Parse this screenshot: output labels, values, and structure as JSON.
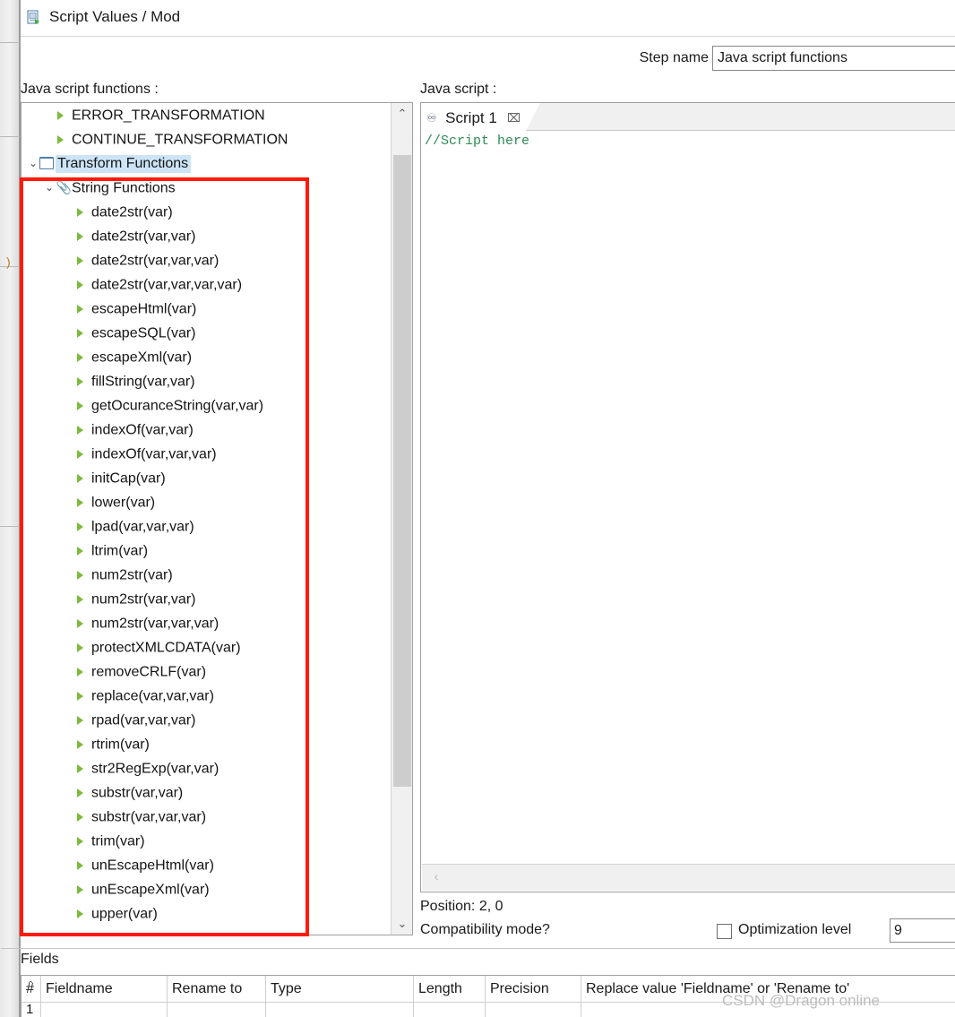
{
  "window": {
    "title": "Script Values / Mod",
    "title_icon": "script-document-icon"
  },
  "step": {
    "label": "Step name",
    "value": "Java script functions",
    "placeholder": ""
  },
  "left_panel": {
    "label": "Java script functions :",
    "tree": [
      {
        "level": 1,
        "icon": "green-arrow-icon",
        "label": "ERROR_TRANSFORMATION",
        "selected": false,
        "twisty": ""
      },
      {
        "level": 1,
        "icon": "green-arrow-icon",
        "label": "CONTINUE_TRANSFORMATION",
        "selected": false,
        "twisty": ""
      },
      {
        "level": 0,
        "icon": "folder-icon",
        "label": "Transform Functions",
        "selected": true,
        "twisty": "⌄"
      },
      {
        "level": 1,
        "icon": "clip-icon",
        "label": "String Functions",
        "selected": false,
        "twisty": "⌄"
      },
      {
        "level": 2,
        "icon": "green-arrow-icon",
        "label": "date2str(var)",
        "selected": false,
        "twisty": ""
      },
      {
        "level": 2,
        "icon": "green-arrow-icon",
        "label": "date2str(var,var)",
        "selected": false,
        "twisty": ""
      },
      {
        "level": 2,
        "icon": "green-arrow-icon",
        "label": "date2str(var,var,var)",
        "selected": false,
        "twisty": ""
      },
      {
        "level": 2,
        "icon": "green-arrow-icon",
        "label": "date2str(var,var,var,var)",
        "selected": false,
        "twisty": ""
      },
      {
        "level": 2,
        "icon": "green-arrow-icon",
        "label": "escapeHtml(var)",
        "selected": false,
        "twisty": ""
      },
      {
        "level": 2,
        "icon": "green-arrow-icon",
        "label": "escapeSQL(var)",
        "selected": false,
        "twisty": ""
      },
      {
        "level": 2,
        "icon": "green-arrow-icon",
        "label": "escapeXml(var)",
        "selected": false,
        "twisty": ""
      },
      {
        "level": 2,
        "icon": "green-arrow-icon",
        "label": "fillString(var,var)",
        "selected": false,
        "twisty": ""
      },
      {
        "level": 2,
        "icon": "green-arrow-icon",
        "label": "getOcuranceString(var,var)",
        "selected": false,
        "twisty": ""
      },
      {
        "level": 2,
        "icon": "green-arrow-icon",
        "label": "indexOf(var,var)",
        "selected": false,
        "twisty": ""
      },
      {
        "level": 2,
        "icon": "green-arrow-icon",
        "label": "indexOf(var,var,var)",
        "selected": false,
        "twisty": ""
      },
      {
        "level": 2,
        "icon": "green-arrow-icon",
        "label": "initCap(var)",
        "selected": false,
        "twisty": ""
      },
      {
        "level": 2,
        "icon": "green-arrow-icon",
        "label": "lower(var)",
        "selected": false,
        "twisty": ""
      },
      {
        "level": 2,
        "icon": "green-arrow-icon",
        "label": "lpad(var,var,var)",
        "selected": false,
        "twisty": ""
      },
      {
        "level": 2,
        "icon": "green-arrow-icon",
        "label": "ltrim(var)",
        "selected": false,
        "twisty": ""
      },
      {
        "level": 2,
        "icon": "green-arrow-icon",
        "label": "num2str(var)",
        "selected": false,
        "twisty": ""
      },
      {
        "level": 2,
        "icon": "green-arrow-icon",
        "label": "num2str(var,var)",
        "selected": false,
        "twisty": ""
      },
      {
        "level": 2,
        "icon": "green-arrow-icon",
        "label": "num2str(var,var,var)",
        "selected": false,
        "twisty": ""
      },
      {
        "level": 2,
        "icon": "green-arrow-icon",
        "label": "protectXMLCDATA(var)",
        "selected": false,
        "twisty": ""
      },
      {
        "level": 2,
        "icon": "green-arrow-icon",
        "label": "removeCRLF(var)",
        "selected": false,
        "twisty": ""
      },
      {
        "level": 2,
        "icon": "green-arrow-icon",
        "label": "replace(var,var,var)",
        "selected": false,
        "twisty": ""
      },
      {
        "level": 2,
        "icon": "green-arrow-icon",
        "label": "rpad(var,var,var)",
        "selected": false,
        "twisty": ""
      },
      {
        "level": 2,
        "icon": "green-arrow-icon",
        "label": "rtrim(var)",
        "selected": false,
        "twisty": ""
      },
      {
        "level": 2,
        "icon": "green-arrow-icon",
        "label": "str2RegExp(var,var)",
        "selected": false,
        "twisty": ""
      },
      {
        "level": 2,
        "icon": "green-arrow-icon",
        "label": "substr(var,var)",
        "selected": false,
        "twisty": ""
      },
      {
        "level": 2,
        "icon": "green-arrow-icon",
        "label": "substr(var,var,var)",
        "selected": false,
        "twisty": ""
      },
      {
        "level": 2,
        "icon": "green-arrow-icon",
        "label": "trim(var)",
        "selected": false,
        "twisty": ""
      },
      {
        "level": 2,
        "icon": "green-arrow-icon",
        "label": "unEscapeHtml(var)",
        "selected": false,
        "twisty": ""
      },
      {
        "level": 2,
        "icon": "green-arrow-icon",
        "label": "unEscapeXml(var)",
        "selected": false,
        "twisty": ""
      },
      {
        "level": 2,
        "icon": "green-arrow-icon",
        "label": "upper(var)",
        "selected": false,
        "twisty": ""
      }
    ],
    "scrollbar": {
      "up_arrow": "⌃",
      "down_arrow": "⌄"
    }
  },
  "right_panel": {
    "label": "Java script :",
    "tab": {
      "icon": "script-tab-icon",
      "label": "Script 1",
      "close": "⌧"
    },
    "editor_text": "//Script here",
    "hscroll_left_arrow": "‹"
  },
  "status": {
    "position": "Position: 2, 0",
    "compatibility": "Compatibility mode?",
    "optimization_label": "Optimization level",
    "optimization_value": "9",
    "optimization_checked": false
  },
  "fields": {
    "label": "Fields",
    "sort_caret": "⌃",
    "columns": [
      "#",
      "Fieldname",
      "Rename to",
      "Type",
      "Length",
      "Precision",
      "Replace value 'Fieldname' or 'Rename to'"
    ],
    "rows": [
      {
        "num": "1",
        "fieldname": "",
        "rename_to": "",
        "type": "",
        "length": "",
        "precision": "",
        "replace": ""
      }
    ]
  },
  "watermark": "CSDN @Dragon online",
  "colors": {
    "annotation_red": "#ff1a08",
    "selection_blue": "#cde4f7",
    "arrow_green": "#7dba3c",
    "script_comment_green": "#2e8b57"
  }
}
